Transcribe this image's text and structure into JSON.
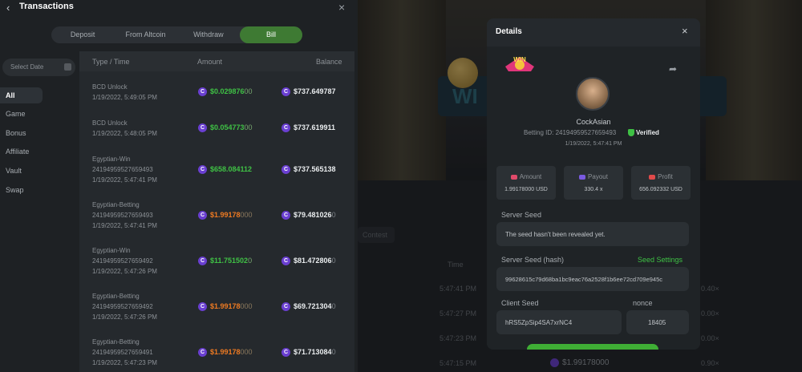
{
  "panel": {
    "title": "Transactions",
    "tabs": [
      {
        "label": "Deposit",
        "active": false
      },
      {
        "label": "From Altcoin",
        "active": false
      },
      {
        "label": "Withdraw",
        "active": false
      },
      {
        "label": "Bill",
        "active": true
      }
    ],
    "date_select": "Select Date",
    "sidebar": [
      "All",
      "Game",
      "Bonus",
      "Affiliate",
      "Vault",
      "Swap"
    ],
    "columns": {
      "type": "Type / Time",
      "amount": "Amount",
      "balance": "Balance"
    },
    "rows": [
      {
        "type": "BCD Unlock",
        "id": "",
        "time": "1/19/2022, 5:49:05 PM",
        "amount": "$0.029876",
        "amount_trail": "00",
        "amount_color": "green",
        "balance": "$737.649787",
        "balance_trail": ""
      },
      {
        "type": "BCD Unlock",
        "id": "",
        "time": "1/19/2022, 5:48:05 PM",
        "amount": "$0.054773",
        "amount_trail": "00",
        "amount_color": "green",
        "balance": "$737.619911",
        "balance_trail": ""
      },
      {
        "type": "Egyptian-Win",
        "id": "24194959527659493",
        "time": "1/19/2022, 5:47:41 PM",
        "amount": "$658.084112",
        "amount_trail": "",
        "amount_color": "green",
        "balance": "$737.565138",
        "balance_trail": ""
      },
      {
        "type": "Egyptian-Betting",
        "id": "24194959527659493",
        "time": "1/19/2022, 5:47:41 PM",
        "amount": "$1.99178",
        "amount_trail": "000",
        "amount_color": "orange",
        "balance": "$79.481026",
        "balance_trail": "0"
      },
      {
        "type": "Egyptian-Win",
        "id": "24194959527659492",
        "time": "1/19/2022, 5:47:26 PM",
        "amount": "$11.751502",
        "amount_trail": "0",
        "amount_color": "green",
        "balance": "$81.472806",
        "balance_trail": "0"
      },
      {
        "type": "Egyptian-Betting",
        "id": "24194959527659492",
        "time": "1/19/2022, 5:47:26 PM",
        "amount": "$1.99178",
        "amount_trail": "000",
        "amount_color": "orange",
        "balance": "$69.721304",
        "balance_trail": "0"
      },
      {
        "type": "Egyptian-Betting",
        "id": "24194959527659491",
        "time": "1/19/2022, 5:47:23 PM",
        "amount": "$1.99178",
        "amount_trail": "000",
        "amount_color": "orange",
        "balance": "$71.713084",
        "balance_trail": "0"
      }
    ]
  },
  "background": {
    "banner_text": "WI",
    "contest_label": "Contest",
    "time_header": "Time",
    "times": [
      "5:47:41 PM",
      "5:47:27 PM",
      "5:47:23 PM",
      "5:47:15 PM"
    ],
    "bottom_amount": "$1.99178000",
    "payouts": [
      "0.40×",
      "0.00×",
      "0.00×",
      "0.90×"
    ]
  },
  "modal": {
    "title": "Details",
    "logo_text": "WIN",
    "user_name": "CockAsian",
    "betting_id": "Betting ID: 24194959527659493",
    "verified": "Verified",
    "time": "1/19/2022, 5:47:41 PM",
    "stats": [
      {
        "label": "Amount",
        "value": "1.99178000 USD",
        "color": "#e04a6a"
      },
      {
        "label": "Payout",
        "value": "330.4 x",
        "color": "#7a5ae0"
      },
      {
        "label": "Profit",
        "value": "656.092332 USD",
        "color": "#e04a4a"
      }
    ],
    "server_seed_label": "Server Seed",
    "server_seed_value": "The seed hasn't been revealed yet.",
    "server_seed_hash_label": "Server Seed (hash)",
    "seed_settings": "Seed Settings",
    "server_seed_hash_value": "99628615c79d68ba1bc9eac76a2528f1b6ee72cd709e945c",
    "client_seed_label": "Client Seed",
    "client_seed_value": "hRS5ZpSip4SA7xrNC4",
    "nonce_label": "nonce",
    "nonce_value": "18405"
  }
}
